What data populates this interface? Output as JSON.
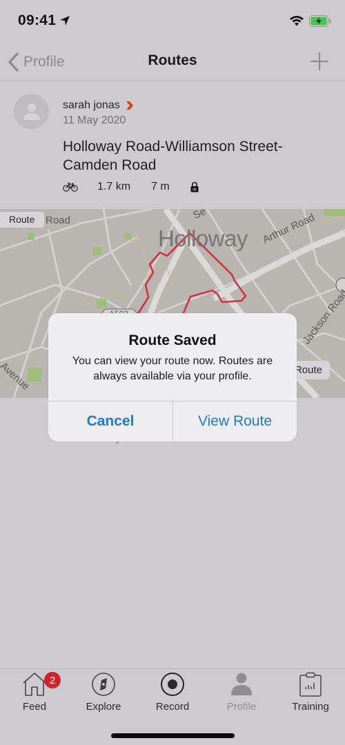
{
  "status_bar": {
    "time": "09:41",
    "icons": [
      "location-arrow-icon",
      "wifi-icon",
      "battery-charging-icon"
    ]
  },
  "nav": {
    "back_label": "Profile",
    "title": "Routes",
    "add_icon": "plus-icon"
  },
  "route": {
    "user_name": "sarah jonas",
    "date": "11 May 2020",
    "name": "Holloway Road-Williamson Street-Camden Road",
    "sport_icon": "bike-icon",
    "distance": "1.7 km",
    "duration": "7 m",
    "privacy_icon": "lock-icon",
    "accent_color": "#d64513"
  },
  "map": {
    "tag": "Route",
    "place_label": "Holloway",
    "street_labels": [
      "Road",
      "Arthur Road",
      "Jackson Road",
      "Avenue",
      "Se",
      "A503"
    ],
    "view_route_label": "Route",
    "route_color": "#d0323f"
  },
  "empty_hint": "Tap the + to add a new route.",
  "alert": {
    "title": "Route Saved",
    "message": "You can view your route now. Routes are always available via your profile.",
    "cancel_label": "Cancel",
    "confirm_label": "View Route",
    "button_color": "#1f7bd4"
  },
  "tab_bar": {
    "tabs": [
      {
        "label": "Feed",
        "icon": "home-icon",
        "badge": "2"
      },
      {
        "label": "Explore",
        "icon": "compass-icon"
      },
      {
        "label": "Record",
        "icon": "record-icon"
      },
      {
        "label": "Profile",
        "icon": "person-icon",
        "active": true
      },
      {
        "label": "Training",
        "icon": "clipboard-chart-icon"
      }
    ]
  }
}
